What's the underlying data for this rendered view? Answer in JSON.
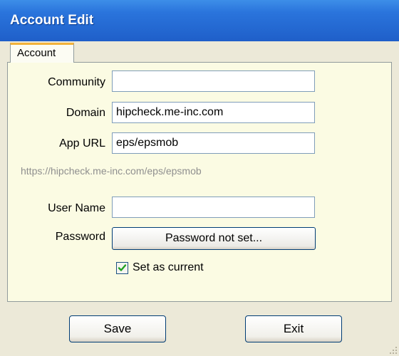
{
  "window": {
    "title": "Account Edit"
  },
  "tabs": [
    {
      "label": "Account",
      "selected": true
    }
  ],
  "form": {
    "community": {
      "label": "Community",
      "value": ""
    },
    "domain": {
      "label": "Domain",
      "value": "hipcheck.me-inc.com"
    },
    "app_url": {
      "label": "App URL",
      "value": "eps/epsmob"
    },
    "url_preview": "https://hipcheck.me-inc.com/eps/epsmob",
    "user_name": {
      "label": "User Name",
      "value": ""
    },
    "password": {
      "label": "Password",
      "button_label": "Password not set..."
    },
    "set_as_current": {
      "label": "Set as current",
      "checked": true
    }
  },
  "actions": {
    "save_label": "Save",
    "exit_label": "Exit"
  },
  "colors": {
    "titlebar": "#2a74dc",
    "panel_background": "#fbfbe3",
    "tab_highlight": "#f2b23a",
    "check_mark": "#21a121"
  }
}
